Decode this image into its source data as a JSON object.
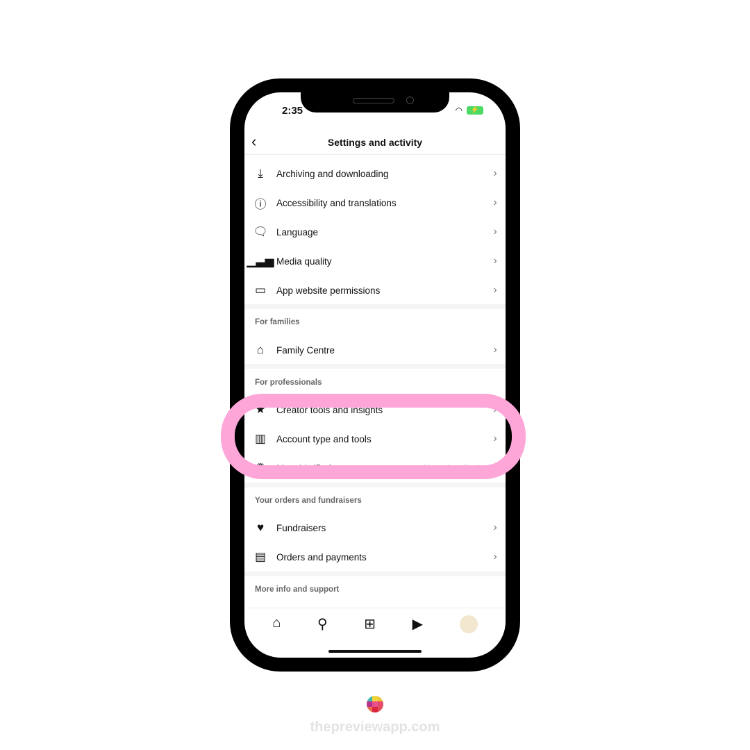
{
  "status": {
    "time": "2:35"
  },
  "header": {
    "title": "Settings and activity",
    "back_icon": "chevron-left-icon"
  },
  "groups": [
    {
      "items": [
        {
          "label": "Archiving and downloading",
          "icon": "download-icon"
        },
        {
          "label": "Accessibility and translations",
          "icon": "accessibility-icon"
        },
        {
          "label": "Language",
          "icon": "translate-icon"
        },
        {
          "label": "Media quality",
          "icon": "signal-bars-icon"
        },
        {
          "label": "App website permissions",
          "icon": "laptop-icon"
        }
      ]
    },
    {
      "title": "For families",
      "items": [
        {
          "label": "Family Centre",
          "icon": "family-home-icon"
        }
      ]
    },
    {
      "title": "For professionals",
      "items": [
        {
          "label": "Creator tools and insights",
          "icon": "creator-icon"
        },
        {
          "label": "Account type and tools",
          "icon": "chart-box-icon"
        },
        {
          "label": "Meta Verified",
          "value": "Not subscribed",
          "icon": "verified-badge-icon"
        }
      ]
    },
    {
      "title": "Your orders and fundraisers",
      "items": [
        {
          "label": "Fundraisers",
          "icon": "heart-circle-icon"
        },
        {
          "label": "Orders and payments",
          "icon": "receipt-icon"
        }
      ]
    },
    {
      "title": "More info and support",
      "items": []
    }
  ],
  "nav": [
    "home-icon",
    "search-icon",
    "create-icon",
    "reels-icon",
    "profile-avatar"
  ],
  "highlight_color": "#ffa6d9",
  "watermark": {
    "text": "thepreviewapp.com"
  }
}
